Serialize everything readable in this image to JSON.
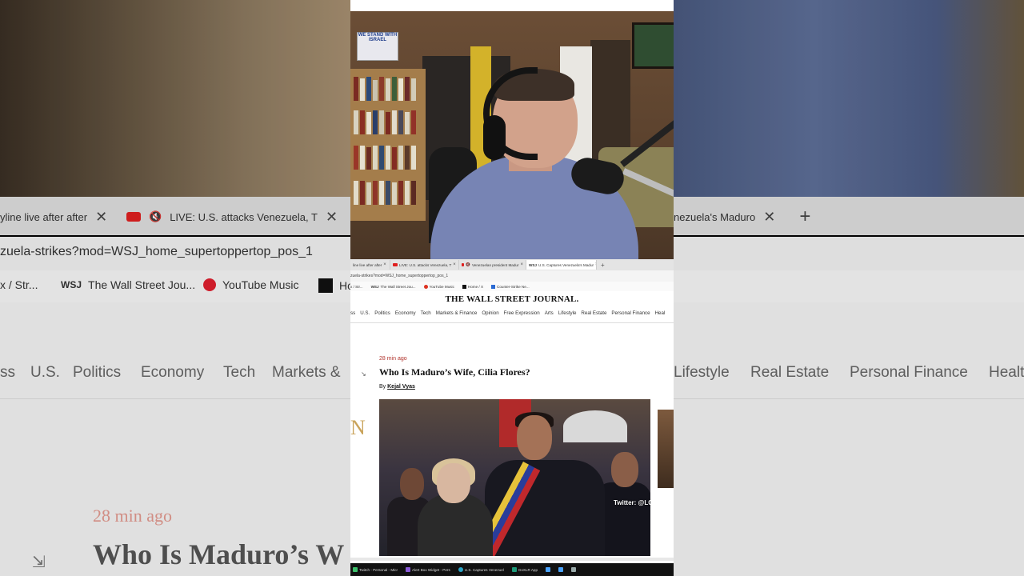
{
  "background": {
    "tabs": [
      {
        "label": "yline live after after"
      },
      {
        "label": "LIVE: U.S. attacks Venezuela, T"
      },
      {
        "label": "nezuela's Maduro"
      }
    ],
    "url": "zuela-strikes?mod=WSJ_home_supertoppertop_pos_1",
    "bookmarks": [
      "x / Str...",
      "The Wall Street Jou...",
      "YouTube Music",
      "Ho"
    ],
    "nav": [
      "ss",
      "U.S.",
      "Politics",
      "Economy",
      "Tech",
      "Markets &",
      "Lifestyle",
      "Real Estate",
      "Personal Finance",
      "Healt"
    ],
    "time_ago": "28 min ago",
    "headline": "Who Is Maduro’s W"
  },
  "camera": {
    "sign_text": "WE STAND WITH ISRAEL"
  },
  "browser": {
    "tabs": [
      {
        "label": "line live after after",
        "close": "×"
      },
      {
        "label": "LIVE: U.S. attacks Venezuela, T",
        "close": "×"
      },
      {
        "label": "Venezuelan president Madur",
        "close": "×"
      },
      {
        "label": "U.S. Captures Venezuela's Madur",
        "close": "×",
        "active": true
      }
    ],
    "new_tab": "+",
    "url": "zuela-strikes?mod=WSJ_home_supertoppertop_pos_1",
    "bookmarks": [
      "x / Str...",
      "The Wall Street Jou...",
      "YouTube Music",
      "Home / X",
      "Counter-Strike Ne..."
    ]
  },
  "article": {
    "masthead": "THE WALL STREET JOURNAL.",
    "nav": [
      "ss",
      "U.S.",
      "Politics",
      "Economy",
      "Tech",
      "Markets & Finance",
      "Opinion",
      "Free Expression",
      "Arts",
      "Lifestyle",
      "Real Estate",
      "Personal Finance",
      "Heal"
    ],
    "time_ago": "28 min ago",
    "headline": "Who Is Maduro’s Wife, Cilia Flores?",
    "byline_prefix": "By",
    "author": "Kejal Vyas",
    "photo_credit": "Twitter: @LC",
    "side_letter": "N"
  },
  "taskbar": {
    "items": [
      "Twitch - Personal - Micr",
      "Alert Box Widget - Pers",
      "U.S. Captures Venezuel",
      "GoXLR App"
    ]
  }
}
